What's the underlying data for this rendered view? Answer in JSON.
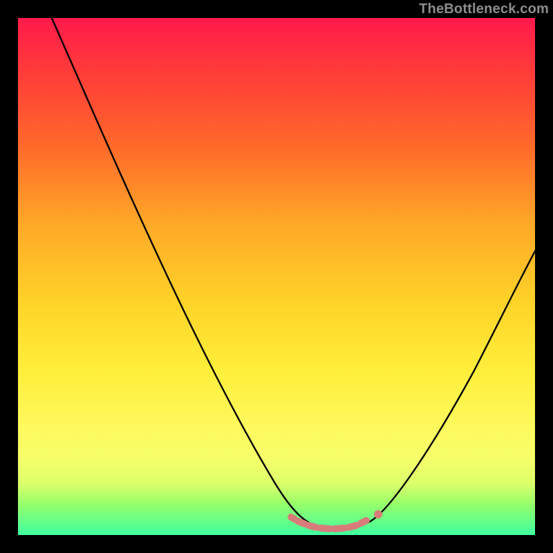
{
  "watermark": "TheBottleneck.com",
  "chart_data": {
    "type": "line",
    "title": "",
    "xlabel": "",
    "ylabel": "",
    "xlim": [
      0,
      100
    ],
    "ylim": [
      0,
      100
    ],
    "series": [
      {
        "name": "bottleneck-curve",
        "x": [
          0,
          4,
          8,
          12,
          16,
          20,
          24,
          28,
          32,
          36,
          40,
          44,
          48,
          52,
          55,
          57,
          59,
          61,
          63,
          65,
          67,
          70,
          74,
          78,
          82,
          86,
          90,
          94,
          98,
          100
        ],
        "values": [
          105,
          100,
          93,
          86,
          79,
          72,
          65,
          58,
          51,
          44,
          37,
          30,
          24,
          18,
          12,
          8,
          5,
          3,
          2,
          2,
          3,
          5,
          10,
          17,
          25,
          33,
          41,
          49,
          56,
          59
        ]
      }
    ],
    "markers": [
      {
        "name": "flat-region-highlight",
        "x_range": [
          55,
          67
        ],
        "y": 2,
        "style": "pink-dotted-band"
      },
      {
        "name": "right-knee-marker",
        "x": 68,
        "y": 5,
        "style": "pink-dot"
      }
    ],
    "background": "rainbow-vertical-gradient",
    "colors": {
      "curve": "#000000",
      "marker": "#d87b7b",
      "frame": "#000000"
    }
  }
}
